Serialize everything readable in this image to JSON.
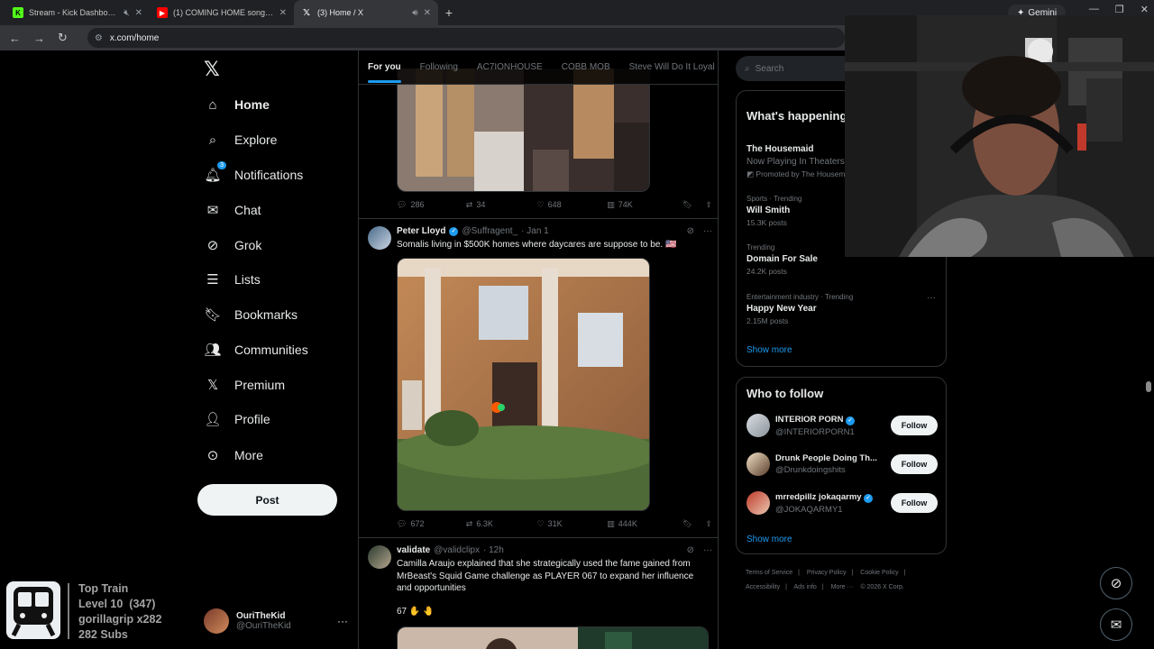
{
  "browser": {
    "tabs": [
      {
        "title": "Stream - Kick Dashboard",
        "favicon": "kick-logo",
        "color": "#53fc18"
      },
      {
        "title": "(1) COMING HOME song - YouTube",
        "favicon": "youtube-logo",
        "color": "#ff0000"
      },
      {
        "title": "(3) Home / X",
        "favicon": "x-logo",
        "color": "#ffffff"
      }
    ],
    "gemini_label": "Gemini",
    "url": "x.com/home"
  },
  "nav": {
    "items": [
      {
        "label": "Home",
        "icon": "home-icon"
      },
      {
        "label": "Explore",
        "icon": "search-icon"
      },
      {
        "label": "Notifications",
        "icon": "bell-icon",
        "badge": "3"
      },
      {
        "label": "Chat",
        "icon": "mail-icon"
      },
      {
        "label": "Grok",
        "icon": "grok-icon"
      },
      {
        "label": "Lists",
        "icon": "list-icon"
      },
      {
        "label": "Bookmarks",
        "icon": "bookmark-icon"
      },
      {
        "label": "Communities",
        "icon": "communities-icon"
      },
      {
        "label": "Premium",
        "icon": "x-premium-icon"
      },
      {
        "label": "Profile",
        "icon": "profile-icon"
      },
      {
        "label": "More",
        "icon": "more-circle-icon"
      }
    ],
    "post_label": "Post",
    "account": {
      "name": "OuriTheKid",
      "handle": "@OuriTheKid"
    }
  },
  "feed": {
    "tabs": [
      "For you",
      "Following",
      "AC7IONHOUSE",
      "COBB MOB",
      "Steve Will Do It Loyal"
    ],
    "tweets": [
      {
        "stats": {
          "replies": "286",
          "reposts": "34",
          "likes": "648",
          "views": "74K"
        }
      },
      {
        "name": "Peter Lloyd",
        "handle": "@Suffragent_",
        "time": "· Jan 1",
        "text": "Somalis living in $500K homes where daycares are suppose to be. 🇺🇸",
        "stats": {
          "replies": "672",
          "reposts": "6.3K",
          "likes": "31K",
          "views": "444K"
        }
      },
      {
        "name": "validate",
        "handle": "@validclipx",
        "time": "· 12h",
        "text": "Camilla Araujo explained that she strategically used the fame gained from MrBeast's Squid Game challenge as PLAYER 067 to expand her influence and opportunities",
        "text2": "67 ✋ 🤚"
      }
    ]
  },
  "sidebar": {
    "search_placeholder": "Search",
    "trending_title": "What's happening",
    "trends": [
      {
        "title": "The Housemaid",
        "subtitle": "Now Playing In Theaters",
        "promo": "Promoted by The Housemaid"
      },
      {
        "category": "Sports · Trending",
        "title": "Will Smith",
        "count": "15.3K posts"
      },
      {
        "category": "Trending",
        "title": "Domain For Sale",
        "count": "24.2K posts"
      },
      {
        "category": "Entertainment industry · Trending",
        "title": "Happy New Year",
        "count": "2.15M posts"
      }
    ],
    "show_more": "Show more",
    "who_to_follow_title": "Who to follow",
    "who_to_follow": [
      {
        "name": "INTERIOR PORN",
        "handle": "@INTERIORPORN1",
        "verified": true
      },
      {
        "name": "Drunk People Doing Th...",
        "handle": "@Drunkdoingshits",
        "verified": false
      },
      {
        "name": "mrredpillz jokaqarmy",
        "handle": "@JOKAQARMY1",
        "verified": true
      }
    ],
    "follow_label": "Follow",
    "footer": [
      "Terms of Service",
      "|",
      "Privacy Policy",
      "|",
      "Cookie Policy",
      "|",
      "Accessibility",
      "|",
      "Ads info",
      "|",
      "More ···",
      "© 2026 X Corp."
    ]
  },
  "overlay": {
    "line1": "Top Train",
    "line2": "Level 10  (347)",
    "line3": "gorillagrip x282",
    "line4": "282 Subs"
  }
}
